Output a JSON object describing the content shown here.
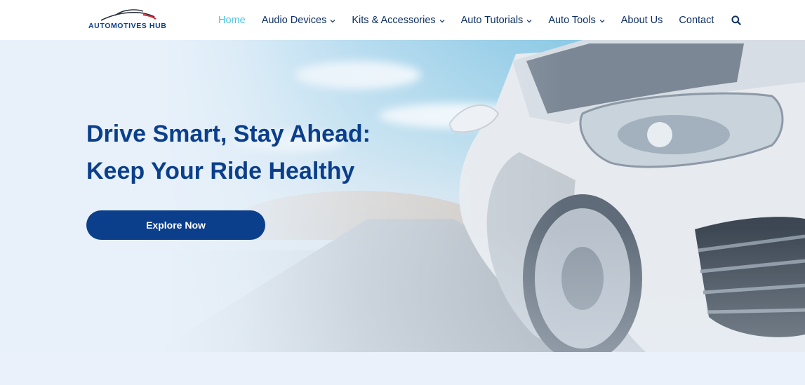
{
  "brand": {
    "name": "AUTOMOTIVES HUB",
    "icon": "car-silhouette-logo",
    "accent": "#0b3f8c",
    "highlight": "#e0252e"
  },
  "nav": {
    "items": [
      {
        "label": "Home",
        "active": true,
        "dropdown": false
      },
      {
        "label": "Audio Devices",
        "active": false,
        "dropdown": true
      },
      {
        "label": "Kits & Accessories",
        "active": false,
        "dropdown": true
      },
      {
        "label": "Auto Tutorials",
        "active": false,
        "dropdown": true
      },
      {
        "label": "Auto Tools",
        "active": false,
        "dropdown": true
      },
      {
        "label": "About Us",
        "active": false,
        "dropdown": false
      },
      {
        "label": "Contact",
        "active": false,
        "dropdown": false
      }
    ],
    "search_icon": "search-icon",
    "active_color": "#4ec3e0",
    "text_color": "#0c2f63"
  },
  "hero": {
    "title_line1": "Drive Smart, Stay Ahead:",
    "title_line2": "Keep Your Ride Healthy",
    "cta_label": "Explore Now",
    "cta_color": "#0b3f8c"
  }
}
